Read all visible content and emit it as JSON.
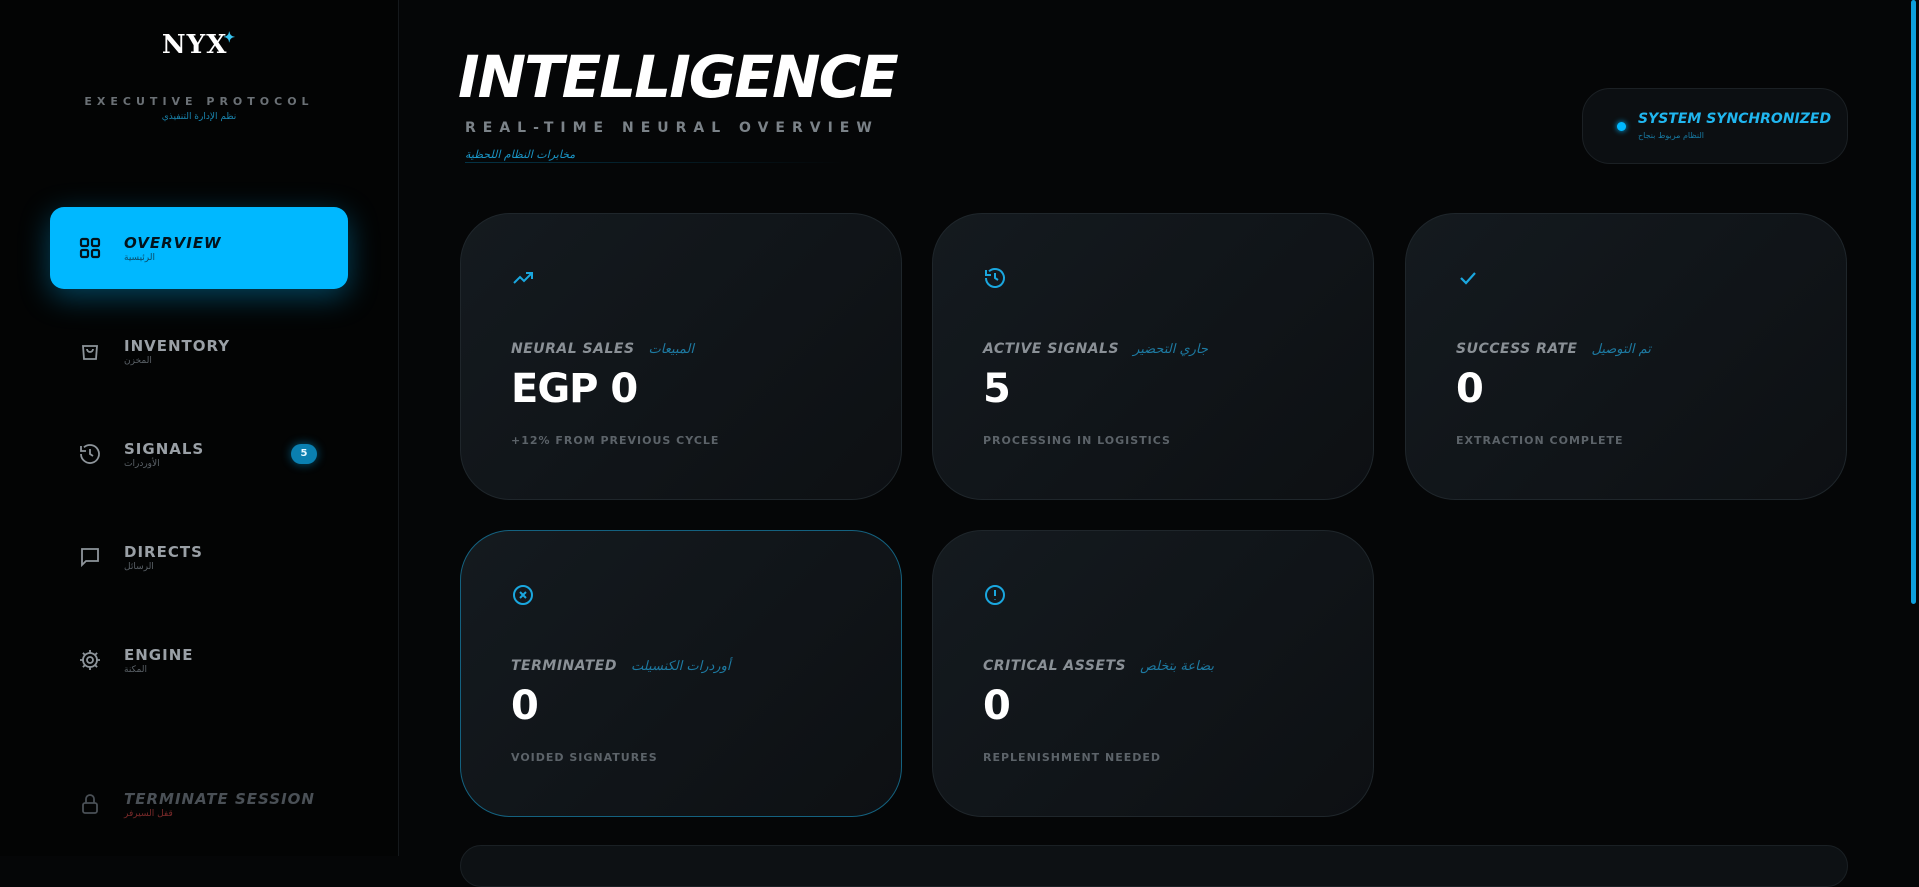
{
  "brand": {
    "logo": "NYX",
    "logo_mark": "✦",
    "subtitle": "EXECUTIVE PROTOCOL",
    "subtitle_ar": "نظم الإدارة التنفيذي"
  },
  "nav": [
    {
      "label": "OVERVIEW",
      "sub": "الرئيسية",
      "icon": "dashboard-icon",
      "active": true
    },
    {
      "label": "INVENTORY",
      "sub": "المخزن",
      "icon": "shopping-bag-icon"
    },
    {
      "label": "SIGNALS",
      "sub": "الأوردرات",
      "icon": "history-icon",
      "badge": "5"
    },
    {
      "label": "DIRECTS",
      "sub": "الرسائل",
      "icon": "message-icon"
    },
    {
      "label": "ENGINE",
      "sub": "المكنة",
      "icon": "gear-icon"
    }
  ],
  "logout": {
    "label": "TERMINATE SESSION",
    "sub": "قفل السيرفر",
    "icon": "lock-icon"
  },
  "header": {
    "title": "INTELLIGENCE",
    "subtitle": "REAL-TIME NEURAL OVERVIEW",
    "subtitle_ar": "مخابرات النظام اللحظية"
  },
  "status": {
    "label": "SYSTEM SYNCHRONIZED",
    "sub": "النظام مربوط بنجاح",
    "color": "#00b8ff"
  },
  "cards": [
    {
      "icon": "trending-up-icon",
      "label": "NEURAL SALES",
      "label_ar": "المبيعات",
      "value": "EGP 0",
      "note": "+12% FROM PREVIOUS CYCLE"
    },
    {
      "icon": "history-icon",
      "label": "ACTIVE SIGNALS",
      "label_ar": "جاري التحضير",
      "value": "5",
      "note": "PROCESSING IN LOGISTICS"
    },
    {
      "icon": "check-icon",
      "label": "SUCCESS RATE",
      "label_ar": "تم التوصيل",
      "value": "0",
      "note": "EXTRACTION COMPLETE"
    },
    {
      "icon": "x-circle-icon",
      "label": "TERMINATED",
      "label_ar": "أوردرات الكنسيلت",
      "value": "0",
      "note": "VOIDED SIGNATURES"
    },
    {
      "icon": "alert-circle-icon",
      "label": "CRITICAL ASSETS",
      "label_ar": "بضاعة بتخلص",
      "value": "0",
      "note": "REPLENISHMENT NEEDED"
    }
  ],
  "colors": {
    "accent": "#00b8ff",
    "background": "#050607",
    "card": "#12171b"
  }
}
